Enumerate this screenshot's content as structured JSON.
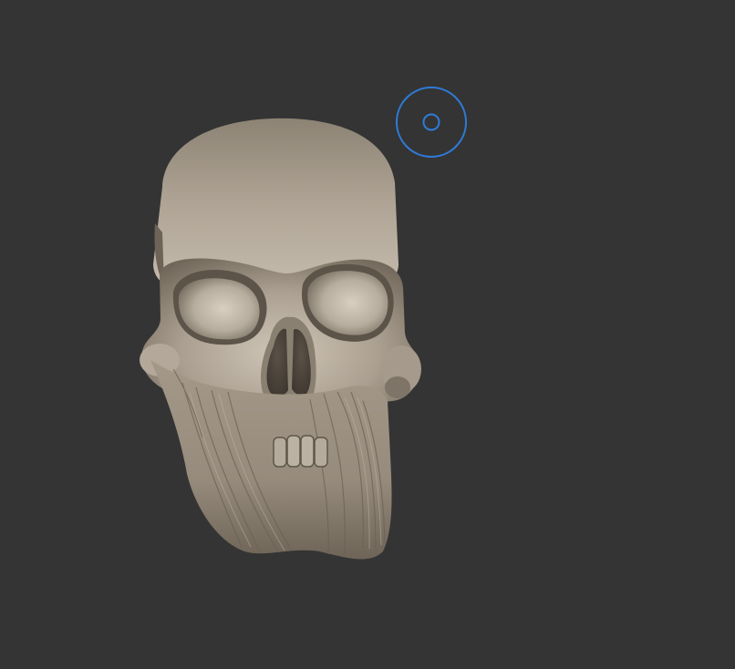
{
  "viewport": {
    "background": "#343434"
  },
  "model": {
    "name": "skull-sculpt",
    "base_color": "#a69b8c",
    "shadow_color": "#4a4238",
    "highlight_color": "#d6cdbf"
  },
  "brush_cursor": {
    "icon": "brush-cursor-icon",
    "color": "#2f7bd8"
  }
}
